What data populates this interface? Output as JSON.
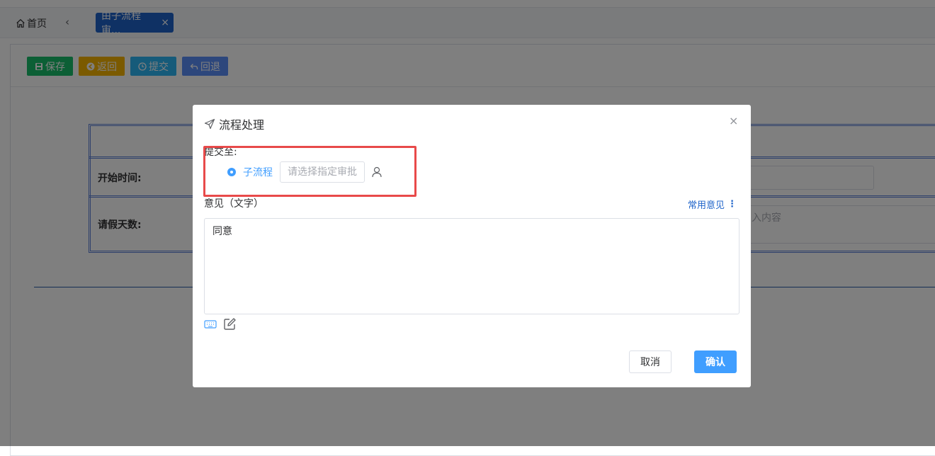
{
  "tabs": {
    "home_label": "首页",
    "active_label": "由子流程审...",
    "close_glyph": "×",
    "back_glyph": "‹"
  },
  "toolbar": {
    "save_label": "保存",
    "back_label": "返回",
    "submit_label": "提交",
    "return_label": "回退"
  },
  "form": {
    "start_time_label": "开始时间:",
    "leave_days_label": "请假天数:",
    "textarea_placeholder_fragment": "入内容"
  },
  "dialog": {
    "title": "流程处理",
    "close_glyph": "×",
    "submit_to_label": "提交至:",
    "option_label": "子流程",
    "approver_placeholder": "请选择指定审批",
    "opinion_label": "意见（文字）",
    "common_opinion_label": "常用意见",
    "common_opinion_glyph": "⋮",
    "opinion_value": "同意",
    "cancel_label": "取消",
    "confirm_label": "确认"
  },
  "colors": {
    "active_tab": "#1e63c9",
    "save": "#19be6b",
    "back": "#f7b500",
    "submit": "#2db7f5",
    "return": "#5b8ff9",
    "primary": "#409eff",
    "highlight": "#e84a4a"
  },
  "icons": [
    "home-icon",
    "save-icon",
    "back-circle-icon",
    "clock-icon",
    "undo-icon",
    "send-icon",
    "close-icon",
    "user-icon",
    "keyboard-icon",
    "edit-icon"
  ]
}
